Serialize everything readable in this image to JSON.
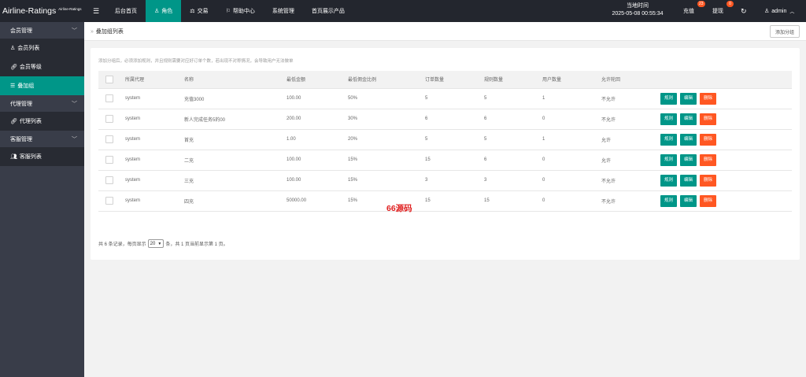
{
  "app": {
    "logo_main": "Airline-Ratings",
    "logo_small": "Airline-Ratings"
  },
  "header": {
    "nav": [
      {
        "label": "后台首页",
        "icon": ""
      },
      {
        "label": "角色",
        "icon": "user-icon"
      },
      {
        "label": "交易",
        "icon": "scale-icon"
      },
      {
        "label": "帮助中心",
        "icon": "flag-icon"
      },
      {
        "label": "系统管理",
        "icon": ""
      },
      {
        "label": "首页展示产品",
        "icon": ""
      }
    ],
    "time_label": "当地时间",
    "time_value": "2025-05-08 00:55:34",
    "recharge_label": "充值",
    "recharge_badge": "23",
    "withdraw_label": "提现",
    "withdraw_badge": "0",
    "user": "admin"
  },
  "sidebar": {
    "groups": [
      {
        "label": "会员管理",
        "items": [
          "会员列表",
          "会员等级",
          "叠加组"
        ]
      },
      {
        "label": "代理管理",
        "items": [
          "代理列表"
        ]
      },
      {
        "label": "客服管理",
        "items": [
          "客服列表"
        ]
      }
    ]
  },
  "page": {
    "breadcrumb": "叠加组列表",
    "add_button": "添加分组",
    "tip": "添加分组后，必须添加规则，并且规则需要对应好订单个数，若出现不对称情况，会导致用户无法做单"
  },
  "table": {
    "headers": [
      "所属代理",
      "名称",
      "最低金额",
      "最低佣金比例",
      "订单数量",
      "规则数量",
      "用户数量",
      "允许轮回"
    ],
    "rows": [
      [
        "system",
        "充值3000",
        "100.00",
        "50%",
        "5",
        "5",
        "1",
        "不允许"
      ],
      [
        "system",
        "新人完成任务5的00",
        "200.00",
        "30%",
        "6",
        "6",
        "0",
        "不允许"
      ],
      [
        "system",
        "首充",
        "1.00",
        "20%",
        "5",
        "5",
        "1",
        "允许"
      ],
      [
        "system",
        "二充",
        "100.00",
        "15%",
        "15",
        "6",
        "0",
        "允许"
      ],
      [
        "system",
        "三充",
        "100.00",
        "15%",
        "3",
        "3",
        "0",
        "不允许"
      ],
      [
        "system",
        "四充",
        "50000.00",
        "15%",
        "15",
        "15",
        "0",
        "不允许"
      ]
    ],
    "action_labels": {
      "rules": "规则",
      "edit": "编辑",
      "delete": "删除"
    }
  },
  "pager": {
    "text_before": "共 6 条记录，每页显示",
    "per_page": "20",
    "text_after": "条，共 1 页当前显示第 1 页。"
  },
  "watermark": "66源码",
  "colors": {
    "accent": "#009688",
    "danger": "#ff5722",
    "topbar": "#23262e",
    "sidebar": "#393d49"
  }
}
